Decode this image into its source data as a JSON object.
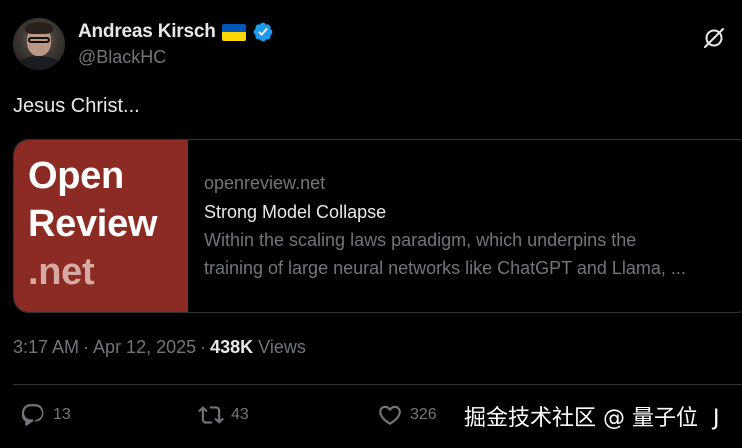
{
  "author": {
    "name": "Andreas Kirsch",
    "handle": "@BlackHC",
    "flag_icon": "ukraine-flag-icon",
    "verified_icon": "verified-badge-icon",
    "verified_color": "#1d9bf0"
  },
  "header": {
    "grok_icon": "grok-icon"
  },
  "tweet": {
    "text": "Jesus Christ..."
  },
  "card": {
    "thumbnail": {
      "line1": "Open",
      "line2": "Review",
      "line3": ".net",
      "background": "#8c2b23"
    },
    "domain": "openreview.net",
    "title": "Strong Model Collapse",
    "description_line1": "Within the scaling laws paradigm, which underpins the",
    "description_line2": "training of large neural networks like ChatGPT and Llama, ..."
  },
  "meta": {
    "time": "3:17 AM",
    "separator1": "·",
    "date": "Apr 12, 2025",
    "separator2": "·",
    "views_count": "438K",
    "views_label": "Views"
  },
  "actions": {
    "replies": {
      "icon": "reply-icon",
      "count": "13"
    },
    "reposts": {
      "icon": "repost-icon",
      "count": "43"
    },
    "likes": {
      "icon": "like-icon",
      "count": "326"
    }
  },
  "watermark": {
    "text": "掘金技术社区 @ 量子位",
    "trailing": "J"
  }
}
